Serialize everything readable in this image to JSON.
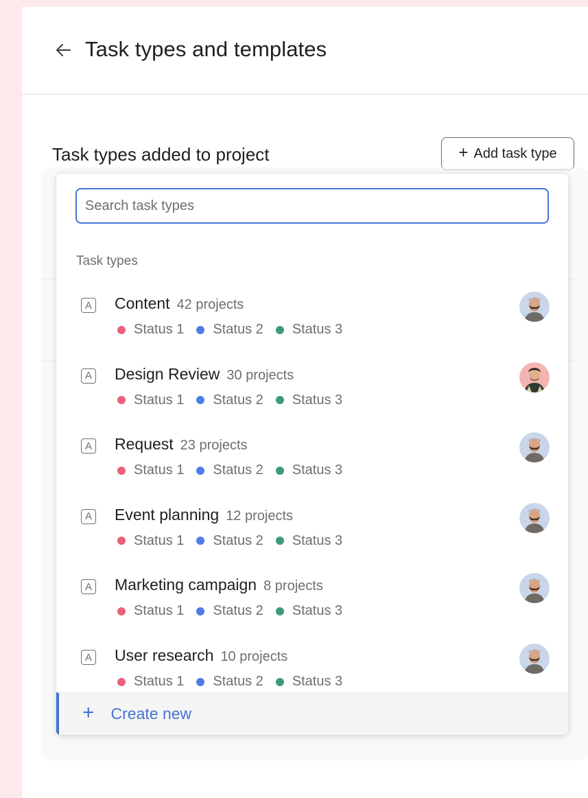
{
  "header": {
    "title": "Task types and templates"
  },
  "section": {
    "title": "Task types added to project",
    "add_button_label": "Add task type"
  },
  "search": {
    "placeholder": "Search task types"
  },
  "list": {
    "heading": "Task types",
    "status_colors": [
      "#e8627a",
      "#4d7de8",
      "#3e9b77"
    ],
    "items": [
      {
        "icon": "A",
        "name": "Content",
        "count": "42 projects",
        "statuses": [
          "Status 1",
          "Status 2",
          "Status 3"
        ],
        "avatar": "avatar-man-beard"
      },
      {
        "icon": "A",
        "name": "Design Review",
        "count": "30 projects",
        "statuses": [
          "Status 1",
          "Status 2",
          "Status 3"
        ],
        "avatar": "avatar-man-smiling"
      },
      {
        "icon": "A",
        "name": "Request",
        "count": "23 projects",
        "statuses": [
          "Status 1",
          "Status 2",
          "Status 3"
        ],
        "avatar": "avatar-man-beard"
      },
      {
        "icon": "A",
        "name": "Event planning",
        "count": "12 projects",
        "statuses": [
          "Status 1",
          "Status 2",
          "Status 3"
        ],
        "avatar": "avatar-man-beard"
      },
      {
        "icon": "A",
        "name": "Marketing campaign",
        "count": "8 projects",
        "statuses": [
          "Status 1",
          "Status 2",
          "Status 3"
        ],
        "avatar": "avatar-man-beard"
      },
      {
        "icon": "A",
        "name": "User research",
        "count": "10 projects",
        "statuses": [
          "Status 1",
          "Status 2",
          "Status 3"
        ],
        "avatar": "avatar-man-beard"
      }
    ]
  },
  "footer": {
    "create_label": "Create new"
  }
}
